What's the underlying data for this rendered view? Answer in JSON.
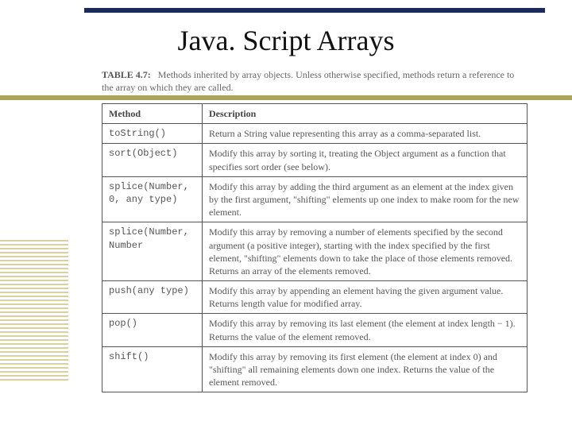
{
  "title": "Java. Script Arrays",
  "caption": {
    "label": "TABLE 4.7:",
    "text": "Methods inherited by array objects. Unless otherwise specified, methods return a reference to the array on which they are called."
  },
  "table": {
    "headers": {
      "method": "Method",
      "description": "Description"
    },
    "rows": [
      {
        "method": "toString()",
        "description": "Return a String value representing this array as a comma-separated list."
      },
      {
        "method": "sort(Object)",
        "description": "Modify this array by sorting it, treating the Object argument as a function that specifies sort order (see below)."
      },
      {
        "method": "splice(Number, 0, any type)",
        "description": "Modify this array by adding the third argument as an element at the index given by the first argument, \"shifting\" elements up one index to make room for the new element."
      },
      {
        "method": "splice(Number, Number",
        "description": "Modify this array by removing a number of elements specified by the second argument (a positive integer), starting with the index specified by the first element, \"shifting\" elements down to take the place of those elements removed. Returns an array of the elements removed."
      },
      {
        "method": "push(any type)",
        "description": "Modify this array by appending an element having the given argument value. Returns length value for modified array."
      },
      {
        "method": "pop()",
        "description": "Modify this array by removing its last element (the element at index length − 1). Returns the value of the element removed."
      },
      {
        "method": "shift()",
        "description": "Modify this array by removing its first element (the element at index 0) and \"shifting\" all remaining elements down one index. Returns the value of the element removed."
      }
    ]
  }
}
